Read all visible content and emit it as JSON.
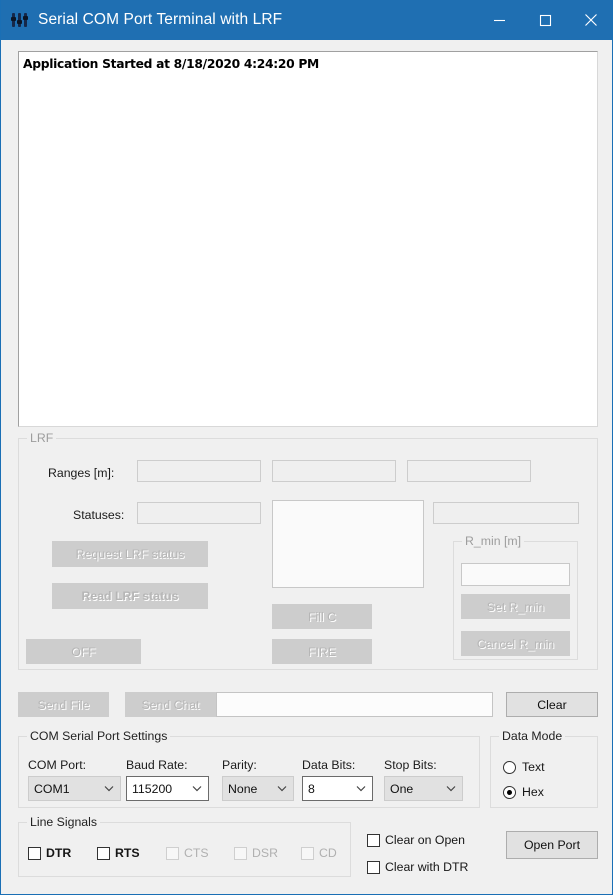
{
  "window": {
    "title": "Serial COM Port Terminal with LRF",
    "icon": "serial-port-icon",
    "accent_color": "#1f6fb2",
    "controls": {
      "minimize": "minimize-icon",
      "maximize": "maximize-icon",
      "close": "close-icon"
    }
  },
  "log": {
    "lines": [
      "Application Started at 8/18/2020 4:24:20 PM"
    ]
  },
  "lrf": {
    "title": "LRF",
    "ranges_label": "Ranges [m]:",
    "ranges_values": [
      "",
      "",
      ""
    ],
    "statuses_label": "Statuses:",
    "statuses_values": [
      "",
      ""
    ],
    "status_multiline_value": "",
    "buttons": {
      "request_status": "Request LRF status",
      "read_status": "Read LRF status",
      "off": "OFF",
      "fill_c": "Fill C",
      "fire": "FIRE"
    },
    "r_min": {
      "title": "R_min [m]",
      "value": "",
      "set_label": "Set R_min",
      "cancel_label": "Cancel R_min"
    }
  },
  "send_row": {
    "send_file": "Send File",
    "send_chat": "Send Chat",
    "message_value": "",
    "clear": "Clear"
  },
  "com_settings": {
    "title": "COM Serial Port Settings",
    "fields": [
      {
        "label": "COM Port:",
        "value": "COM1",
        "style": "gray"
      },
      {
        "label": "Baud Rate:",
        "value": "115200",
        "style": "white"
      },
      {
        "label": "Parity:",
        "value": "None",
        "style": "gray"
      },
      {
        "label": "Data Bits:",
        "value": "8",
        "style": "white"
      },
      {
        "label": "Stop Bits:",
        "value": "One",
        "style": "gray"
      }
    ]
  },
  "data_mode": {
    "title": "Data Mode",
    "options": [
      {
        "label": "Text",
        "selected": false
      },
      {
        "label": "Hex",
        "selected": true
      }
    ]
  },
  "line_signals": {
    "title": "Line Signals",
    "items": [
      {
        "label": "DTR",
        "enabled": true,
        "checked": false
      },
      {
        "label": "RTS",
        "enabled": true,
        "checked": false
      },
      {
        "label": "CTS",
        "enabled": false,
        "checked": false
      },
      {
        "label": "DSR",
        "enabled": false,
        "checked": false
      },
      {
        "label": "CD",
        "enabled": false,
        "checked": false
      }
    ]
  },
  "clear_options": [
    {
      "label": "Clear on Open",
      "checked": false
    },
    {
      "label": "Clear with DTR",
      "checked": false
    }
  ],
  "open_port_button": "Open Port"
}
